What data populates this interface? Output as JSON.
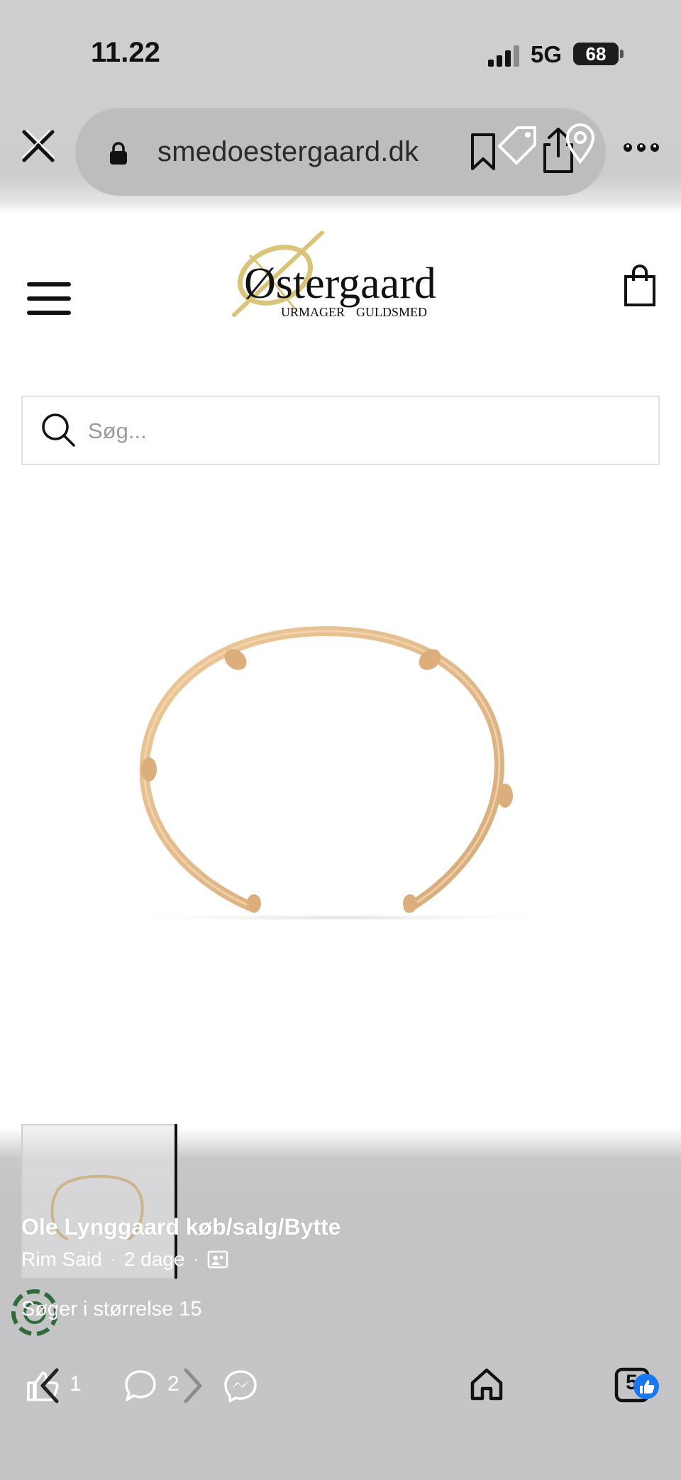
{
  "status_bar": {
    "time": "11.22",
    "network": "5G",
    "battery": "68"
  },
  "browser": {
    "url": "smedoestergaard.dk"
  },
  "site": {
    "logo_wordmark": "Østergaard",
    "logo_subline_left": "URMAGER",
    "logo_subline_right": "GULDSMED",
    "search_placeholder": "Søg..."
  },
  "post": {
    "title": "Ole Lynggaard køb/salg/Bytte",
    "author": "Rim Said",
    "time_ago": "2 dage",
    "text": "Søger i størrelse 15",
    "likes": "1",
    "comments": "2",
    "tabs_count": "5"
  },
  "icons": {
    "close": "close-icon",
    "lock": "lock-icon",
    "bookmark": "bookmark-icon",
    "tag": "tag-icon",
    "share": "share-icon",
    "pin": "location-pin-icon",
    "more": "more-icon",
    "menu": "hamburger-menu-icon",
    "cart": "shopping-bag-icon",
    "search": "search-icon",
    "like": "thumbs-up-icon",
    "comment": "comment-icon",
    "messenger": "messenger-icon",
    "home": "home-icon",
    "group": "group-icon"
  },
  "colors": {
    "brand_gold": "#d9c57a",
    "bracelet_gold": "#e2b98a",
    "facebook_blue": "#1877f2",
    "overlay_grey": "#c4c4c6"
  }
}
